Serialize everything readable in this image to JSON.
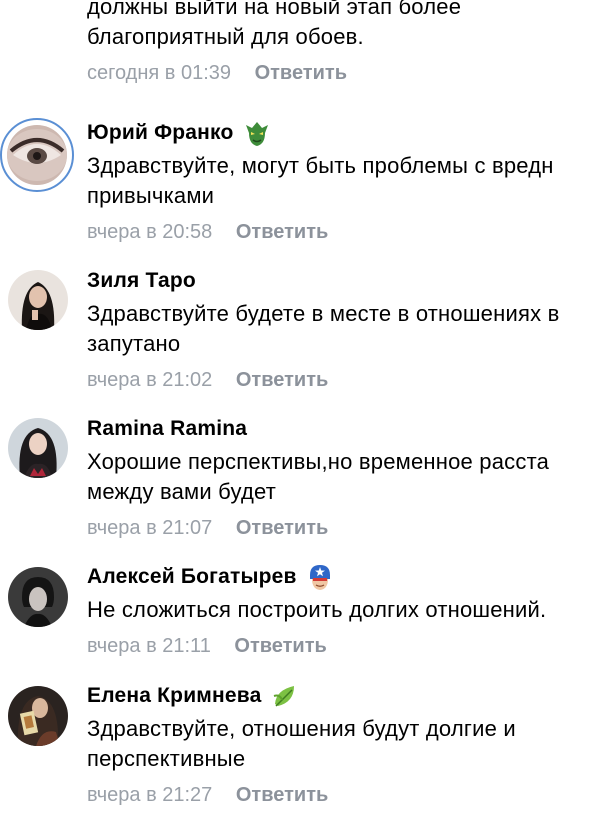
{
  "top": {
    "text_lines": [
      "должны выйти на новый этап более",
      "благоприятный для обоев."
    ],
    "time": "сегодня в 01:39",
    "reply": "Ответить"
  },
  "comments": [
    {
      "name": "Юрий Франко",
      "badge_icon": "goblin-mask-icon",
      "text_lines": [
        "Здравствуйте, могут быть проблемы с вредн",
        "привычками"
      ],
      "time": "вчера в 20:58",
      "reply": "Ответить"
    },
    {
      "name": "Зиля Таро",
      "text_lines": [
        "Здравствуйте будете в месте в отношениях в",
        "запутано"
      ],
      "time": "вчера в 21:02",
      "reply": "Ответить"
    },
    {
      "name": "Ramina Ramina",
      "text_lines": [
        "Хорошие перспективы,но временное расста",
        "между вами будет"
      ],
      "time": "вчера в 21:07",
      "reply": "Ответить"
    },
    {
      "name": "Алексей Богатырев",
      "badge_icon": "captain-mask-icon",
      "text_lines": [
        "Не сложиться построить  долгих отношений."
      ],
      "time": "вчера в 21:11",
      "reply": "Ответить"
    },
    {
      "name": "Елена Кримнева",
      "badge_icon": "leaf-icon",
      "text_lines": [
        "Здравствуйте, отношения  будут долгие и",
        "перспективные"
      ],
      "time": "вчера в 21:27",
      "reply": "Ответить"
    }
  ],
  "colors": {
    "meta": "#9aa0a8",
    "reply": "#8c929b",
    "ring": "#5a8fd4"
  }
}
